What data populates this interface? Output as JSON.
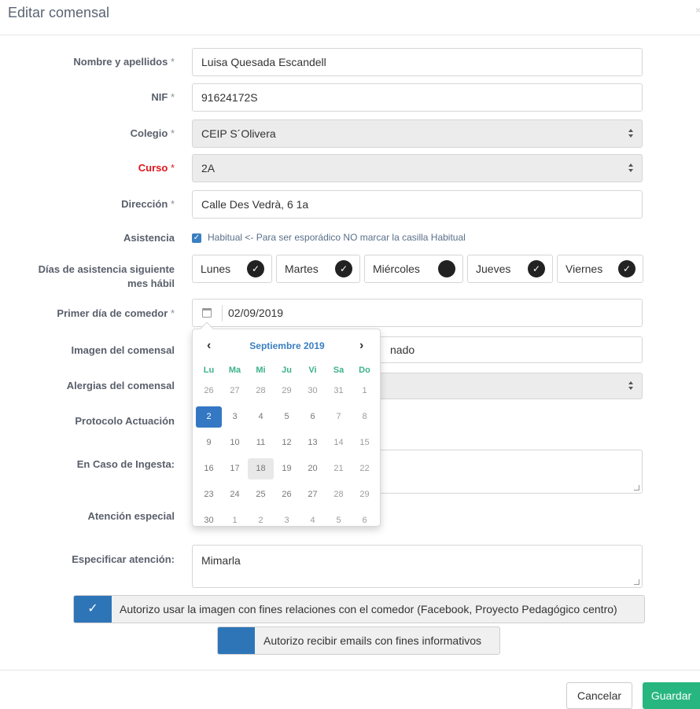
{
  "modal": {
    "title": "Editar comensal",
    "close_glyph": "×"
  },
  "fields": {
    "nombre": {
      "label": "Nombre y apellidos",
      "required": "*",
      "value": "Luisa Quesada Escandell"
    },
    "nif": {
      "label": "NIF",
      "required": "*",
      "value": "91624172S"
    },
    "colegio": {
      "label": "Colegio",
      "required": "*",
      "value": "CEIP S´Olivera"
    },
    "curso": {
      "label": "Curso",
      "required": "*",
      "value": "2A"
    },
    "direccion": {
      "label": "Dirección",
      "required": "*",
      "value": "Calle Des Vedrà, 6 1a"
    },
    "asistencia": {
      "label": "Asistencia",
      "checkbox_text": "Habitual <- Para ser esporádico NO marcar la casilla Habitual"
    },
    "dias": {
      "label_line1": "Días de asistencia siguiente",
      "label_line2": "mes hábil",
      "days": [
        {
          "name": "Lunes",
          "checked": true
        },
        {
          "name": "Martes",
          "checked": true
        },
        {
          "name": "Miércoles",
          "checked": false
        },
        {
          "name": "Jueves",
          "checked": true
        },
        {
          "name": "Viernes",
          "checked": true
        }
      ]
    },
    "primer_dia": {
      "label": "Primer día de comedor",
      "required": "*",
      "value": "02/09/2019"
    },
    "imagen": {
      "label": "Imagen del comensal",
      "value_partial": "nado"
    },
    "alergias": {
      "label": "Alergias del comensal"
    },
    "protocolo": {
      "label": "Protocolo Actuación"
    },
    "ingesta": {
      "label": "En Caso de Ingesta:"
    },
    "atencion": {
      "label": "Atención especial"
    },
    "especificar": {
      "label": "Especificar atención:",
      "value": "Mimarla"
    }
  },
  "datepicker": {
    "month": "Septiembre 2019",
    "prev_glyph": "‹",
    "next_glyph": "›",
    "weekdays": [
      "Lu",
      "Ma",
      "Mi",
      "Ju",
      "Vi",
      "Sa",
      "Do"
    ],
    "weeks": [
      [
        "26",
        "27",
        "28",
        "29",
        "30",
        "31",
        "1"
      ],
      [
        "2",
        "3",
        "4",
        "5",
        "6",
        "7",
        "8"
      ],
      [
        "9",
        "10",
        "11",
        "12",
        "13",
        "14",
        "15"
      ],
      [
        "16",
        "17",
        "18",
        "19",
        "20",
        "21",
        "22"
      ],
      [
        "23",
        "24",
        "25",
        "26",
        "27",
        "28",
        "29"
      ],
      [
        "30",
        "1",
        "2",
        "3",
        "4",
        "5",
        "6"
      ]
    ],
    "selected": "2",
    "highlighted": "18"
  },
  "consents": {
    "image": {
      "label": "Autorizo usar la imagen con fines relaciones con el comedor (Facebook, Proyecto Pedagógico centro)",
      "checked": true
    },
    "emails": {
      "label": "Autorizo recibir emails con fines informativos",
      "checked": false
    }
  },
  "footer": {
    "cancel_label": "Cancelar",
    "save_label": "Guardar"
  },
  "colors": {
    "primary": "#3478c4",
    "success": "#27b67f",
    "required_red": "#e0161b",
    "weekday_green": "#3bb38a"
  }
}
